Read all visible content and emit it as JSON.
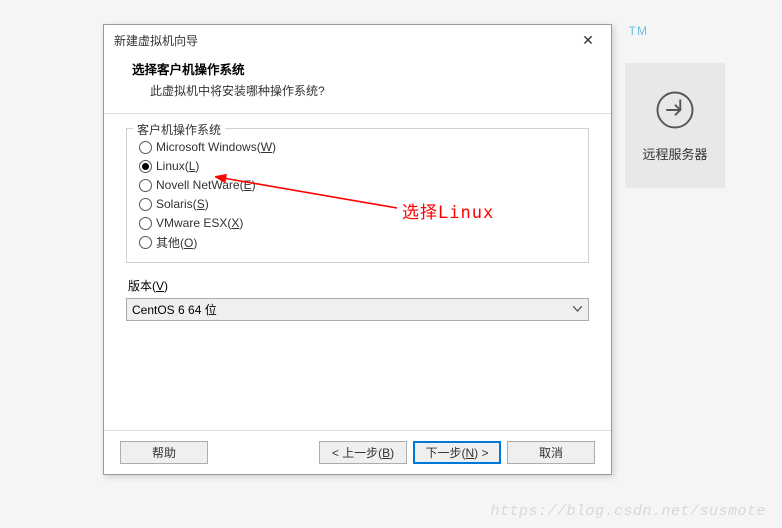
{
  "tm": "TM",
  "bg_button": {
    "label": "远程服务器"
  },
  "dialog": {
    "title": "新建虚拟机向导",
    "heading": "选择客户机操作系统",
    "subheading": "此虚拟机中将安装哪种操作系统?",
    "group_label": "客户机操作系统",
    "options": [
      {
        "label": "Microsoft Windows(",
        "mn": "W",
        "after": ")",
        "checked": false
      },
      {
        "label": "Linux(",
        "mn": "L",
        "after": ")",
        "checked": true
      },
      {
        "label": "Novell NetWare(",
        "mn": "E",
        "after": ")",
        "checked": false
      },
      {
        "label": "Solaris(",
        "mn": "S",
        "after": ")",
        "checked": false
      },
      {
        "label": "VMware ESX(",
        "mn": "X",
        "after": ")",
        "checked": false
      },
      {
        "label": "其他(",
        "mn": "O",
        "after": ")",
        "checked": false
      }
    ],
    "version_label_pre": "版本(",
    "version_label_mn": "V",
    "version_label_post": ")",
    "version_value": "CentOS 6 64 位",
    "buttons": {
      "help": "帮助",
      "back_pre": "< 上一步(",
      "back_mn": "B",
      "back_post": ")",
      "next_pre": "下一步(",
      "next_mn": "N",
      "next_post": ") >",
      "cancel": "取消"
    }
  },
  "annotation": {
    "text": "选择Linux"
  },
  "watermark": "https://blog.csdn.net/susmote"
}
